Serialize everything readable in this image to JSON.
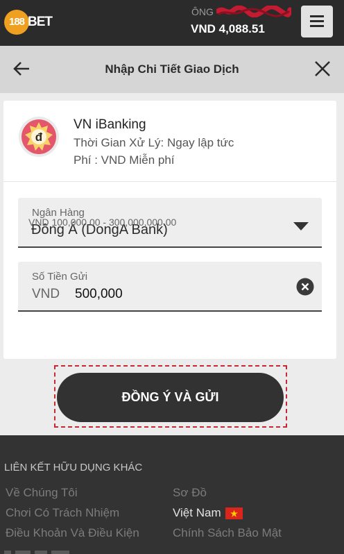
{
  "topbar": {
    "logo_number": "188",
    "logo_word": "BET",
    "user_label": "ÔNG",
    "balance": "VND 4,088.51"
  },
  "header": {
    "title": "Nhập Chi Tiết Giao Dịch"
  },
  "method": {
    "name": "VN iBanking",
    "processing_time": "Thời Gian Xử Lý: Ngay lập tức",
    "fee": "Phí : VND Miễn phí",
    "icon_symbol": "đ"
  },
  "bank_field": {
    "label": "Ngân Hàng",
    "value": "Đông Á (DongA Bank)"
  },
  "amount_field": {
    "label": "Số Tiền Gửi",
    "currency": "VND",
    "value": "500,000",
    "range_hint": "VND 100,000.00 - 300,000,000.00"
  },
  "submit": {
    "label": "ĐỒNG Ý VÀ GỬI"
  },
  "footer": {
    "heading": "LIÊN KẾT HỮU DỤNG KHÁC",
    "links": [
      "Về Chúng Tôi",
      "Sơ Đồ",
      "Chơi Có Trách Nhiệm",
      "Việt Nam",
      "Điều Khoản Và Điều Kiện",
      "Chính Sách Bảo Mật"
    ]
  },
  "colors": {
    "topbar": "#2b2b2b",
    "logo_orange": "#f0a020",
    "header_bg": "#d6d6d6",
    "button_dark": "#323232",
    "footer_bg": "#333333",
    "focus_outline": "#c62836"
  }
}
